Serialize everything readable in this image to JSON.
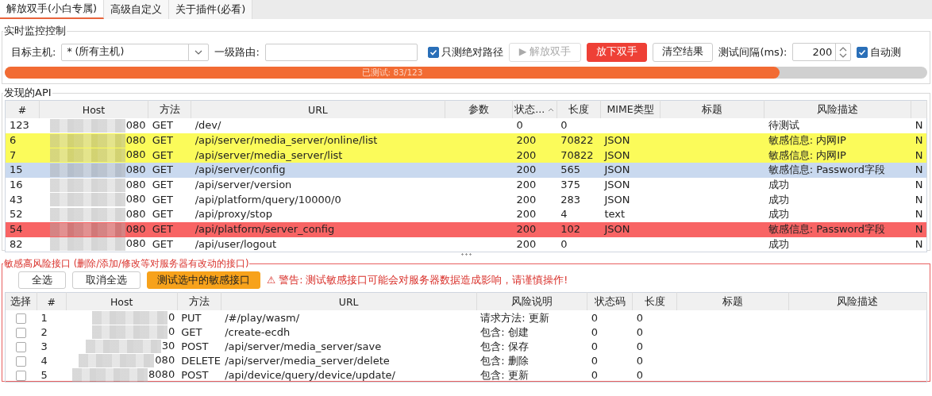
{
  "tabs": [
    {
      "label": "解放双手(小白专属)",
      "selected": true
    },
    {
      "label": "高级自定义",
      "selected": false
    },
    {
      "label": "关于插件(必看)",
      "selected": false
    }
  ],
  "monitor": {
    "title": "实时监控控制",
    "target_label": "目标主机:",
    "target_value": "* (所有主机)",
    "route_label": "一级路由:",
    "abs_path": {
      "label": "只测绝对路径",
      "checked": true
    },
    "start_button": {
      "icon": "▶",
      "label": "解放双手",
      "disabled": true
    },
    "stop_button": "放下双手",
    "clear_button": "清空结果",
    "interval_label": "测试间隔(ms):",
    "interval_value": "200",
    "auto_test": {
      "label": "自动测",
      "checked": true
    },
    "progress": {
      "level": 0.84,
      "text": "已测试: 83/123"
    }
  },
  "api_table": {
    "title": "发现的API",
    "columns": [
      "#",
      "Host",
      "方法",
      "URL",
      "参数",
      "状态...",
      "长度",
      "MIME类型",
      "标题",
      "风险描述",
      ""
    ],
    "rows": [
      {
        "cells": [
          "123",
          "080",
          "GET",
          "/dev/",
          "",
          "0",
          "0",
          "",
          "",
          "待测试",
          "N"
        ],
        "color": "#ffffff",
        "selected": false
      },
      {
        "cells": [
          "6",
          "080",
          "GET",
          "/api/server/media_server/online/list",
          "",
          "200",
          "70822",
          "JSON",
          "",
          "敏感信息: 内网IP",
          "N"
        ],
        "color": "#fbfb5a",
        "selected": false
      },
      {
        "cells": [
          "7",
          "080",
          "GET",
          "/api/server/media_server/list",
          "",
          "200",
          "70822",
          "JSON",
          "",
          "敏感信息: 内网IP",
          "N"
        ],
        "color": "#fbfb5a",
        "selected": false
      },
      {
        "cells": [
          "15",
          "080",
          "GET",
          "/api/server/config",
          "",
          "200",
          "565",
          "JSON",
          "",
          "敏感信息: Password字段",
          "N"
        ],
        "selected": true
      },
      {
        "cells": [
          "16",
          "080",
          "GET",
          "/api/server/version",
          "",
          "200",
          "375",
          "JSON",
          "",
          "成功",
          "N"
        ],
        "color": "#ffffff",
        "selected": false
      },
      {
        "cells": [
          "43",
          "080",
          "GET",
          "/api/platform/query/10000/0",
          "",
          "200",
          "283",
          "JSON",
          "",
          "成功",
          "N"
        ],
        "color": "#ffffff",
        "selected": false
      },
      {
        "cells": [
          "52",
          "080",
          "GET",
          "/api/proxy/stop",
          "",
          "200",
          "4",
          "text",
          "",
          "成功",
          "N"
        ],
        "color": "#ffffff",
        "selected": false
      },
      {
        "cells": [
          "54",
          "080",
          "GET",
          "/api/platform/server_config",
          "",
          "200",
          "102",
          "JSON",
          "",
          "敏感信息: Password字段",
          "N"
        ],
        "color": "#f86464",
        "selected": false
      },
      {
        "cells": [
          "82",
          "080",
          "GET",
          "/api/user/logout",
          "",
          "200",
          "0",
          "",
          "",
          "成功",
          "N"
        ],
        "color": "#ffffff",
        "selected": false
      }
    ]
  },
  "sensitive": {
    "title": "敏感高风险接口 (删除/添加/修改等对服务器有改动的接口)",
    "select_all": "全选",
    "deselect_all": "取消全选",
    "test_button": "测试选中的敏感接口",
    "warning": "⚠ 警告: 测试敏感接口可能会对服务器数据造成影响，请谨慎操作!",
    "columns": [
      "选择",
      "#",
      "Host",
      "方法",
      "URL",
      "风险说明",
      "状态码",
      "长度",
      "标题",
      "风险描述"
    ],
    "rows": [
      {
        "checked": false,
        "cells": [
          "",
          "1",
          "0",
          "PUT",
          "/#/play/wasm/",
          "请求方法: 更新",
          "0",
          "0",
          "",
          ""
        ]
      },
      {
        "checked": false,
        "cells": [
          "",
          "2",
          "0",
          "GET",
          "/create-ecdh",
          "包含: 创建",
          "0",
          "0",
          "",
          ""
        ]
      },
      {
        "checked": false,
        "cells": [
          "",
          "3",
          "30",
          "POST",
          "/api/server/media_server/save",
          "包含: 保存",
          "0",
          "0",
          "",
          ""
        ]
      },
      {
        "checked": false,
        "cells": [
          "",
          "4",
          "080",
          "DELETE",
          "/api/server/media_server/delete",
          "包含: 删除",
          "0",
          "0",
          "",
          ""
        ]
      },
      {
        "checked": false,
        "cells": [
          "",
          "5",
          "8080",
          "POST",
          "/api/device/query/device/update/",
          "包含: 更新",
          "0",
          "0",
          "",
          ""
        ]
      }
    ]
  }
}
